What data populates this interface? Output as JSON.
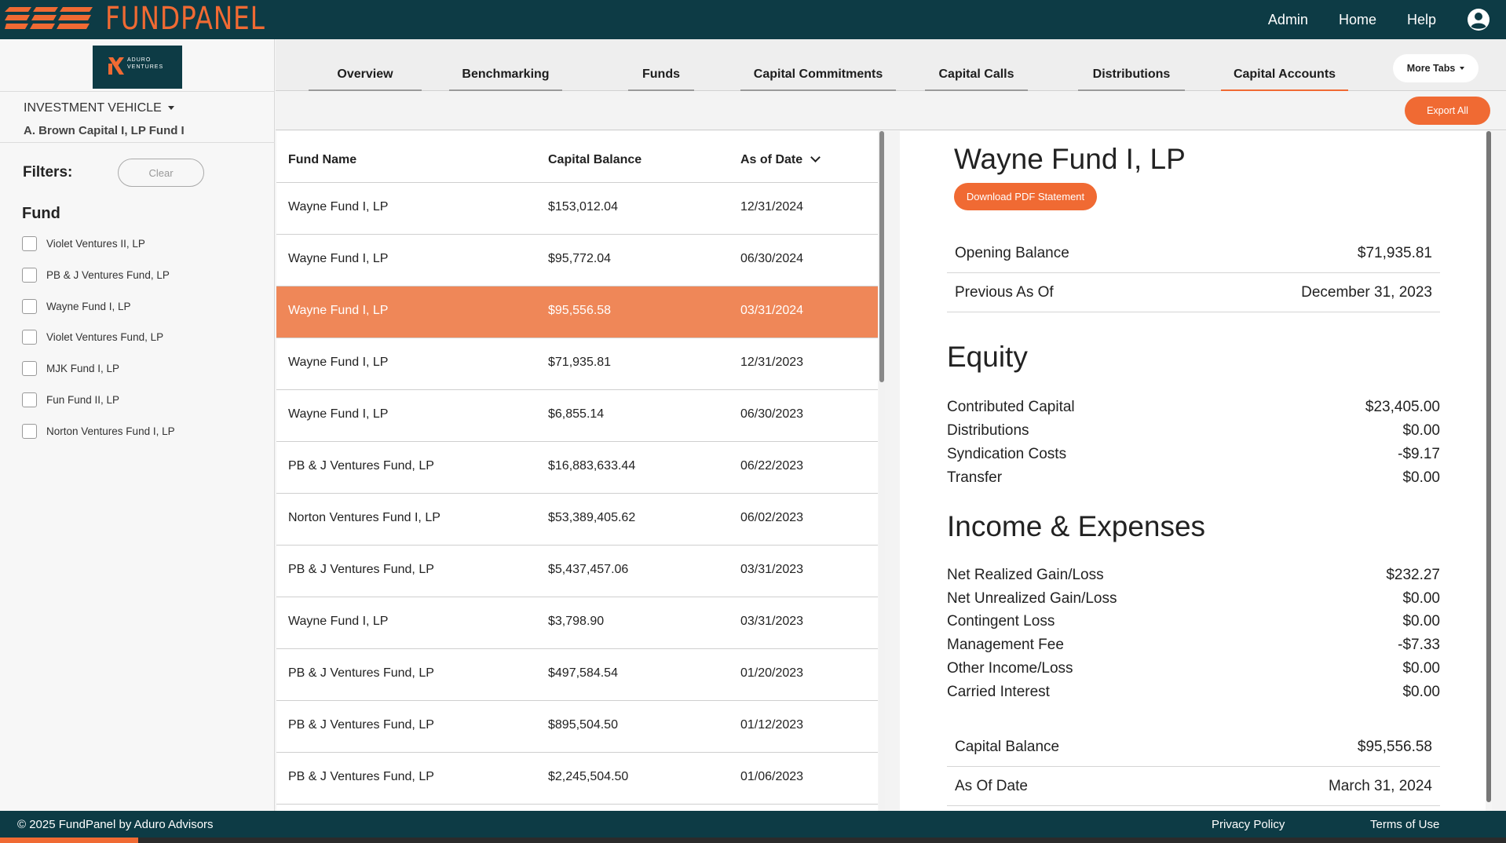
{
  "app": {
    "logo_text": "FUNDPANEL",
    "brand_color": "#f06a33",
    "nav_color": "#0d3b45"
  },
  "topnav": {
    "admin": "Admin",
    "home": "Home",
    "help": "Help",
    "user_icon": "user-circle-icon"
  },
  "sidebar": {
    "brand_line1": "ADURO",
    "brand_line2": "VENTURES",
    "investment_vehicle_label": "INVESTMENT VEHICLE",
    "investment_vehicle_value": "A. Brown Capital I, LP Fund I",
    "filters_label": "Filters:",
    "clear_label": "Clear",
    "fund_heading": "Fund",
    "funds": [
      "Violet Ventures II, LP",
      "PB & J Ventures Fund, LP",
      "Wayne Fund I, LP",
      "Violet Ventures Fund, LP",
      "MJK Fund I, LP",
      "Fun Fund II, LP",
      "Norton Ventures Fund I, LP"
    ]
  },
  "tabs": {
    "overview": "Overview",
    "benchmarking": "Benchmarking",
    "funds": "Funds",
    "capital_commitments": "Capital Commitments",
    "capital_calls": "Capital Calls",
    "distributions": "Distributions",
    "capital_accounts": "Capital Accounts",
    "active": "Capital Accounts",
    "more_tabs": "More Tabs"
  },
  "toolbar": {
    "export_all": "Export All"
  },
  "table": {
    "headers": [
      "Fund Name",
      "Capital Balance",
      "As of Date"
    ],
    "sort_icon": "chevron-down-icon",
    "selected_index": 2,
    "rows": [
      [
        "Wayne Fund I, LP",
        "$153,012.04",
        "12/31/2024"
      ],
      [
        "Wayne Fund I, LP",
        "$95,772.04",
        "06/30/2024"
      ],
      [
        "Wayne Fund I, LP",
        "$95,556.58",
        "03/31/2024"
      ],
      [
        "Wayne Fund I, LP",
        "$71,935.81",
        "12/31/2023"
      ],
      [
        "Wayne Fund I, LP",
        "$6,855.14",
        "06/30/2023"
      ],
      [
        "PB & J Ventures Fund, LP",
        "$16,883,633.44",
        "06/22/2023"
      ],
      [
        "Norton Ventures Fund I, LP",
        "$53,389,405.62",
        "06/02/2023"
      ],
      [
        "PB & J Ventures Fund, LP",
        "$5,437,457.06",
        "03/31/2023"
      ],
      [
        "Wayne Fund I, LP",
        "$3,798.90",
        "03/31/2023"
      ],
      [
        "PB & J Ventures Fund, LP",
        "$497,584.54",
        "01/20/2023"
      ],
      [
        "PB & J Ventures Fund, LP",
        "$895,504.50",
        "01/12/2023"
      ],
      [
        "PB & J Ventures Fund, LP",
        "$2,245,504.50",
        "01/06/2023"
      ]
    ]
  },
  "detail": {
    "title": "Wayne Fund I, LP",
    "download_pdf": "Download PDF Statement",
    "opening_balance_label": "Opening Balance",
    "opening_balance_value": "$71,935.81",
    "previous_as_of_label": "Previous As Of",
    "previous_as_of_value": "December 31, 2023",
    "equity_heading": "Equity",
    "equity": [
      [
        "Contributed Capital",
        "$23,405.00"
      ],
      [
        "Distributions",
        "$0.00"
      ],
      [
        "Syndication Costs",
        "-$9.17"
      ],
      [
        "Transfer",
        "$0.00"
      ]
    ],
    "income_heading": "Income & Expenses",
    "income": [
      [
        "Net Realized Gain/Loss",
        "$232.27"
      ],
      [
        "Net Unrealized Gain/Loss",
        "$0.00"
      ],
      [
        "Contingent Loss",
        "$0.00"
      ],
      [
        "Management Fee",
        "-$7.33"
      ],
      [
        "Other Income/Loss",
        "$0.00"
      ],
      [
        "Carried Interest",
        "$0.00"
      ]
    ],
    "capital_balance_label": "Capital Balance",
    "capital_balance_value": "$95,556.58",
    "as_of_date_label": "As Of Date",
    "as_of_date_value": "March 31, 2024"
  },
  "footer": {
    "copyright": "© 2025 FundPanel by Aduro Advisors",
    "privacy": "Privacy Policy",
    "terms": "Terms of Use"
  }
}
